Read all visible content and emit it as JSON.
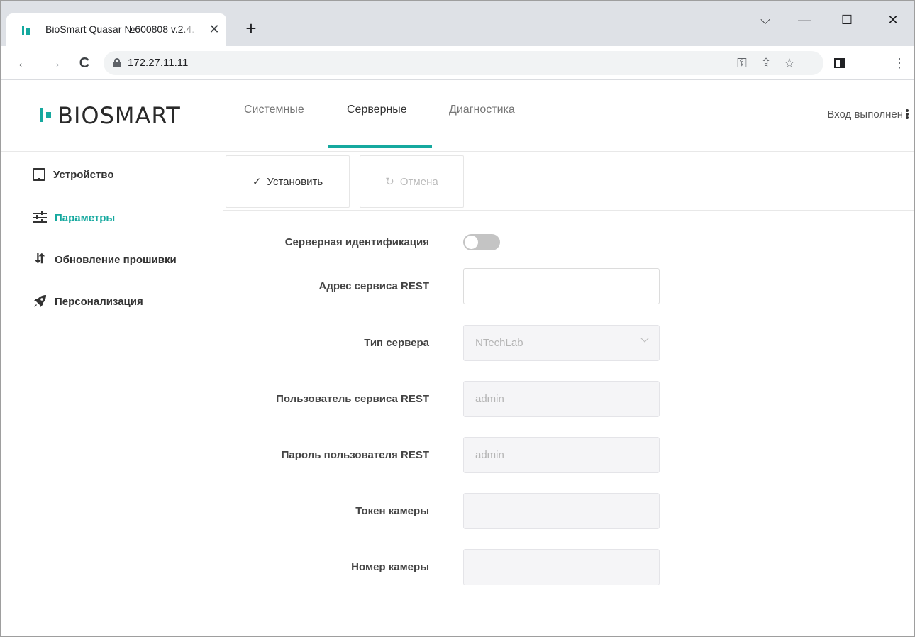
{
  "browser": {
    "tab_title": "BioSmart Quasar №600808 v.2.4.",
    "tab_close": "✕",
    "new_tab": "+",
    "url": "172.27.11.11",
    "window_controls": {
      "list": "⌵",
      "minimize": "—",
      "maximize": "☐",
      "close": "✕"
    },
    "nav": {
      "back": "←",
      "forward": "→",
      "reload": "C"
    },
    "omnibox_icons": {
      "key": "⚿",
      "share": "⇪",
      "star": "☆"
    }
  },
  "app": {
    "logo_text": "BIOSMART",
    "accent_color": "#16a99f",
    "sidebar": {
      "items": [
        {
          "label": "Устройство",
          "icon": "tablet-icon",
          "active": false
        },
        {
          "label": "Параметры",
          "icon": "sliders-icon",
          "active": true
        },
        {
          "label": "Обновление прошивки",
          "icon": "update-icon",
          "active": false
        },
        {
          "label": "Персонализация",
          "icon": "rocket-icon",
          "active": false
        }
      ]
    },
    "tabs": [
      {
        "label": "Системные",
        "active": false
      },
      {
        "label": "Серверные",
        "active": true
      },
      {
        "label": "Диагностика",
        "active": false
      }
    ],
    "login_status": "Вход выполнен",
    "actions": {
      "apply_label": "Установить",
      "apply_icon": "✓",
      "cancel_label": "Отмена",
      "cancel_icon": "↻"
    },
    "form": {
      "server_identification": {
        "label": "Серверная идентификация",
        "enabled": false
      },
      "rest_address": {
        "label": "Адрес сервиса REST",
        "value": ""
      },
      "server_type": {
        "label": "Тип сервера",
        "value": "NTechLab"
      },
      "rest_user": {
        "label": "Пользователь сервиса REST",
        "value": "admin"
      },
      "rest_password": {
        "label": "Пароль пользователя REST",
        "value": "admin"
      },
      "camera_token": {
        "label": "Токен камеры",
        "value": ""
      },
      "camera_number": {
        "label": "Номер камеры",
        "value": ""
      }
    }
  }
}
